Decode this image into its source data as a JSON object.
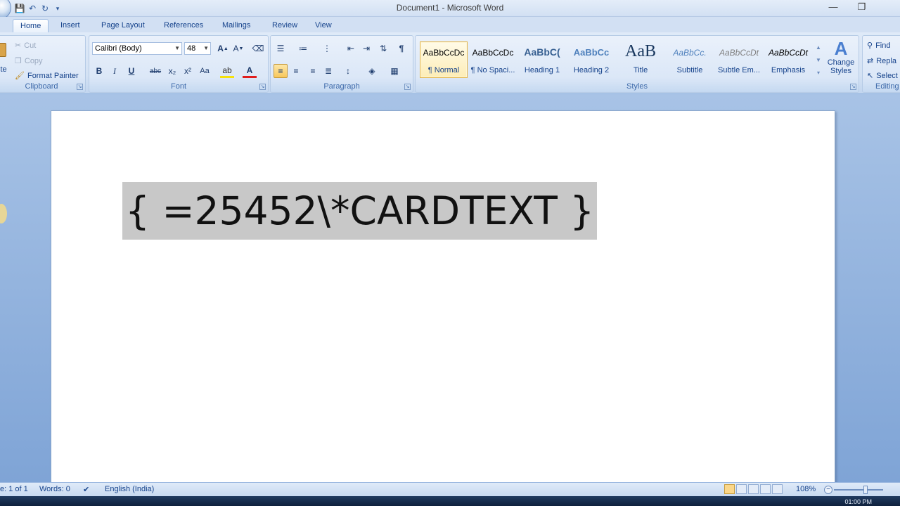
{
  "window": {
    "title": "Document1 - Microsoft Word",
    "controls": [
      "—",
      "❐",
      "✕"
    ]
  },
  "tabs": [
    {
      "label": "Home",
      "active": true
    },
    {
      "label": "Insert"
    },
    {
      "label": "Page Layout"
    },
    {
      "label": "References"
    },
    {
      "label": "Mailings"
    },
    {
      "label": "Review"
    },
    {
      "label": "View"
    }
  ],
  "clipboard": {
    "paste_label": "ste",
    "cut": "Cut",
    "copy": "Copy",
    "format_painter": "Format Painter",
    "group_label": "Clipboard"
  },
  "font": {
    "name": "Calibri (Body)",
    "size": "48",
    "group_label": "Font"
  },
  "paragraph": {
    "group_label": "Paragraph"
  },
  "styles": {
    "items": [
      {
        "sample": "AaBbCcDc",
        "name": "¶ Normal",
        "selected": true
      },
      {
        "sample": "AaBbCcDc",
        "name": "¶ No Spaci..."
      },
      {
        "sample": "AaBbC(",
        "name": "Heading 1"
      },
      {
        "sample": "AaBbCc",
        "name": "Heading 2"
      },
      {
        "sample": "AaB",
        "name": "Title"
      },
      {
        "sample": "AaBbCc.",
        "name": "Subtitle"
      },
      {
        "sample": "AaBbCcDt",
        "name": "Subtle Em..."
      },
      {
        "sample": "AaBbCcDt",
        "name": "Emphasis"
      }
    ],
    "change_styles": "Change Styles",
    "group_label": "Styles"
  },
  "editing": {
    "find": "Find",
    "replace": "Repla",
    "select": "Select",
    "group_label": "Editing"
  },
  "document": {
    "field_code": "{ =25452\\*CARDTEXT }"
  },
  "status": {
    "page": "e: 1 of 1",
    "words": "Words: 0",
    "language": "English (India)",
    "zoom": "108%"
  },
  "taskbar": {
    "time": "01:00 PM"
  }
}
